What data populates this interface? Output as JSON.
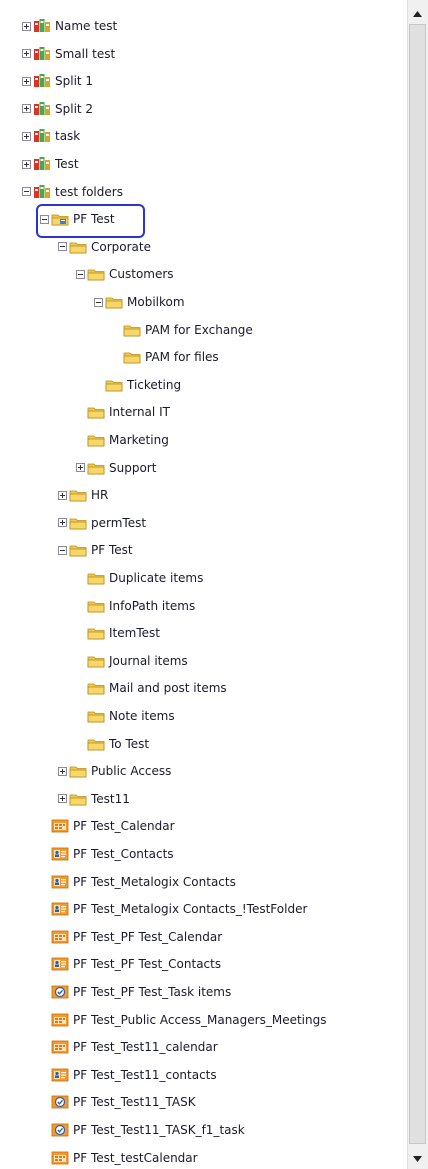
{
  "tree": {
    "items": [
      {
        "label": "Name test",
        "icon": "mailbox-icon",
        "expander": "plus",
        "depth": 0
      },
      {
        "label": "Small test",
        "icon": "mailbox-icon",
        "expander": "plus",
        "depth": 0
      },
      {
        "label": "Split 1",
        "icon": "mailbox-icon",
        "expander": "plus",
        "depth": 0
      },
      {
        "label": "Split 2",
        "icon": "mailbox-icon",
        "expander": "plus",
        "depth": 0
      },
      {
        "label": "task",
        "icon": "mailbox-icon",
        "expander": "plus",
        "depth": 0
      },
      {
        "label": "Test",
        "icon": "mailbox-icon",
        "expander": "plus",
        "depth": 0
      },
      {
        "label": "test folders",
        "icon": "mailbox-icon",
        "expander": "minus",
        "depth": 0
      },
      {
        "label": "PF Test",
        "icon": "public-folder-root-icon",
        "expander": "minus",
        "depth": 1,
        "selected": true
      },
      {
        "label": "Corporate",
        "icon": "folder-icon",
        "expander": "minus",
        "depth": 2
      },
      {
        "label": "Customers",
        "icon": "folder-icon",
        "expander": "minus",
        "depth": 3
      },
      {
        "label": "Mobilkom",
        "icon": "folder-icon",
        "expander": "minus",
        "depth": 4
      },
      {
        "label": "PAM for Exchange",
        "icon": "folder-icon",
        "expander": "none",
        "depth": 5
      },
      {
        "label": "PAM for files",
        "icon": "folder-icon",
        "expander": "none",
        "depth": 5
      },
      {
        "label": "Ticketing",
        "icon": "folder-icon",
        "expander": "none",
        "depth": 4
      },
      {
        "label": "Internal IT",
        "icon": "folder-icon",
        "expander": "none",
        "depth": 3
      },
      {
        "label": "Marketing",
        "icon": "folder-icon",
        "expander": "none",
        "depth": 3
      },
      {
        "label": "Support",
        "icon": "folder-icon",
        "expander": "plus",
        "depth": 3
      },
      {
        "label": "HR",
        "icon": "folder-icon",
        "expander": "plus",
        "depth": 2
      },
      {
        "label": "permTest",
        "icon": "folder-icon",
        "expander": "plus",
        "depth": 2
      },
      {
        "label": "PF Test",
        "icon": "folder-icon",
        "expander": "minus",
        "depth": 2
      },
      {
        "label": "Duplicate items",
        "icon": "folder-icon",
        "expander": "none",
        "depth": 3
      },
      {
        "label": "InfoPath items",
        "icon": "folder-icon",
        "expander": "none",
        "depth": 3
      },
      {
        "label": "ItemTest",
        "icon": "folder-icon",
        "expander": "none",
        "depth": 3
      },
      {
        "label": "Journal items",
        "icon": "folder-icon",
        "expander": "none",
        "depth": 3
      },
      {
        "label": "Mail and post items",
        "icon": "folder-icon",
        "expander": "none",
        "depth": 3
      },
      {
        "label": "Note items",
        "icon": "folder-icon",
        "expander": "none",
        "depth": 3
      },
      {
        "label": "To Test",
        "icon": "folder-icon",
        "expander": "none",
        "depth": 3
      },
      {
        "label": "Public Access",
        "icon": "folder-icon",
        "expander": "plus",
        "depth": 2
      },
      {
        "label": "Test11",
        "icon": "folder-icon",
        "expander": "plus",
        "depth": 2
      },
      {
        "label": "PF Test_Calendar",
        "icon": "calendar-icon",
        "expander": "none",
        "depth": 1
      },
      {
        "label": "PF Test_Contacts",
        "icon": "contacts-icon",
        "expander": "none",
        "depth": 1
      },
      {
        "label": "PF Test_Metalogix Contacts",
        "icon": "contacts-icon",
        "expander": "none",
        "depth": 1
      },
      {
        "label": "PF Test_Metalogix Contacts_!TestFolder",
        "icon": "contacts-icon",
        "expander": "none",
        "depth": 1
      },
      {
        "label": "PF Test_PF Test_Calendar",
        "icon": "calendar-icon",
        "expander": "none",
        "depth": 1
      },
      {
        "label": "PF Test_PF Test_Contacts",
        "icon": "contacts-icon",
        "expander": "none",
        "depth": 1
      },
      {
        "label": "PF Test_PF Test_Task items",
        "icon": "task-icon",
        "expander": "none",
        "depth": 1
      },
      {
        "label": "PF Test_Public Access_Managers_Meetings",
        "icon": "calendar-icon",
        "expander": "none",
        "depth": 1
      },
      {
        "label": "PF Test_Test11_calendar",
        "icon": "calendar-icon",
        "expander": "none",
        "depth": 1
      },
      {
        "label": "PF Test_Test11_contacts",
        "icon": "contacts-icon",
        "expander": "none",
        "depth": 1
      },
      {
        "label": "PF Test_Test11_TASK",
        "icon": "task-icon",
        "expander": "none",
        "depth": 1
      },
      {
        "label": "PF Test_Test11_TASK_f1_task",
        "icon": "task-icon",
        "expander": "none",
        "depth": 1
      },
      {
        "label": "PF Test_testCalendar",
        "icon": "calendar-icon",
        "expander": "none",
        "depth": 1
      }
    ]
  },
  "scrollbar": {
    "up_icon": "scroll-up-arrow-icon",
    "down_icon": "scroll-down-arrow-icon"
  },
  "colors": {
    "selection_outline": "#2b35c9",
    "folder": "#f2c94c",
    "text": "#1a1a2e"
  }
}
